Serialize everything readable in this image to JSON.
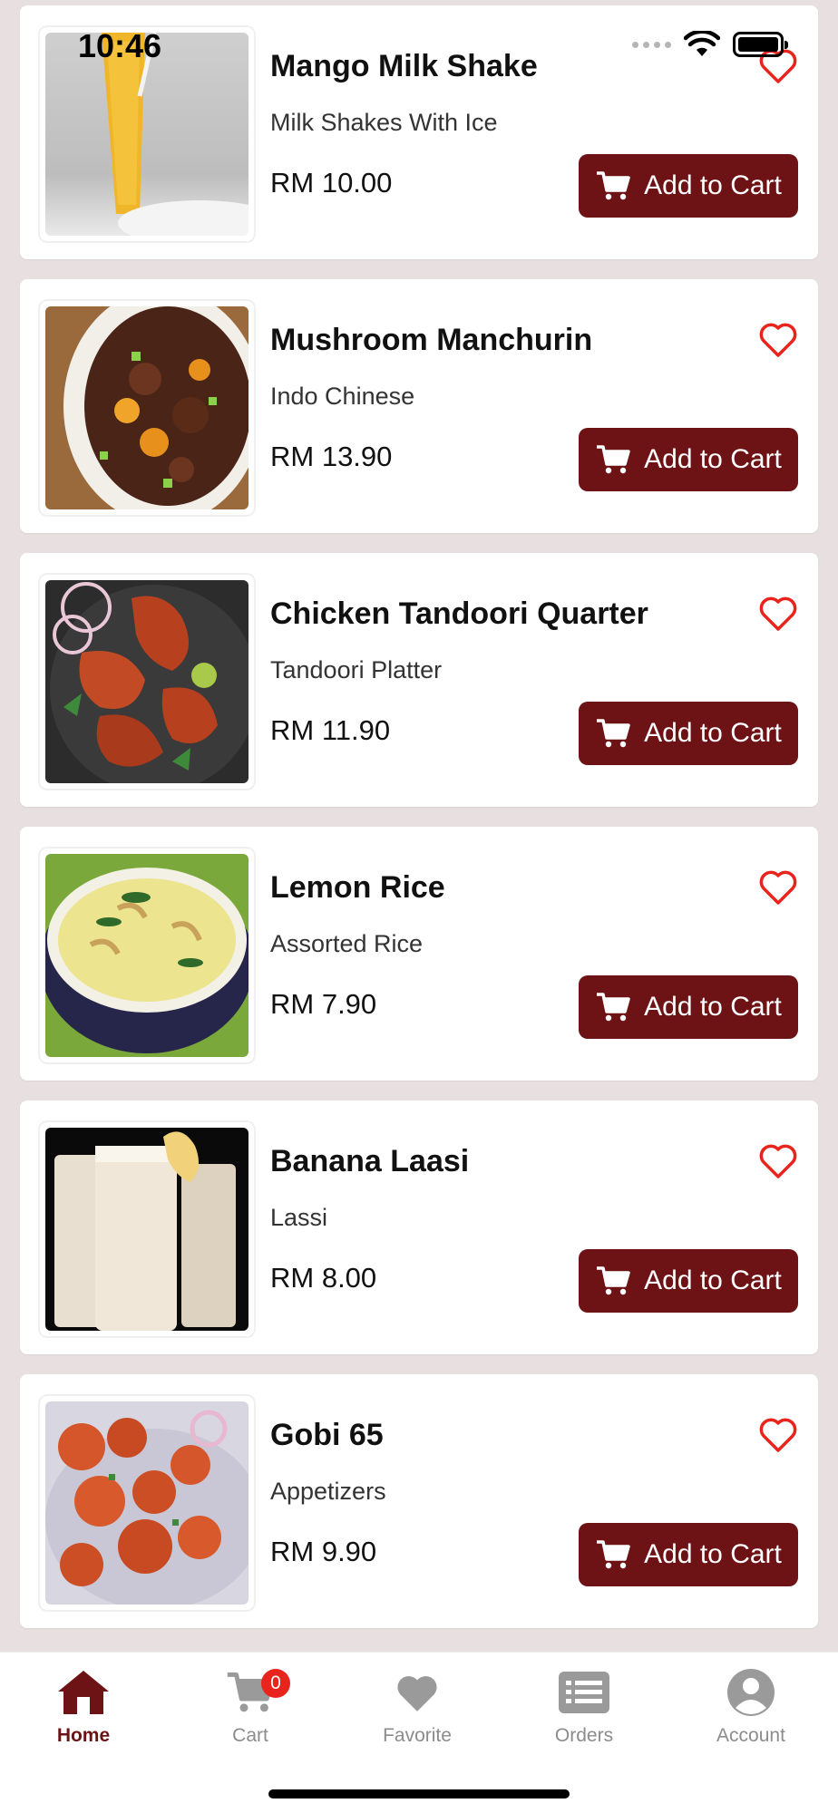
{
  "status_bar": {
    "time": "10:46"
  },
  "items": [
    {
      "name": "Mango Milk Shake",
      "category": "Milk Shakes With Ice",
      "price": "RM 10.00",
      "button": "Add to Cart"
    },
    {
      "name": "Mushroom Manchurin",
      "category": "Indo Chinese",
      "price": "RM 13.90",
      "button": "Add to Cart"
    },
    {
      "name": "Chicken Tandoori Quarter",
      "category": "Tandoori Platter",
      "price": "RM 11.90",
      "button": "Add to Cart"
    },
    {
      "name": "Lemon Rice",
      "category": "Assorted Rice",
      "price": "RM 7.90",
      "button": "Add to Cart"
    },
    {
      "name": "Banana Laasi",
      "category": "Lassi",
      "price": "RM 8.00",
      "button": "Add to Cart"
    },
    {
      "name": "Gobi 65",
      "category": "Appetizers",
      "price": "RM 9.90",
      "button": "Add to Cart"
    }
  ],
  "nav": {
    "home": "Home",
    "cart": "Cart",
    "cart_count": "0",
    "favorite": "Favorite",
    "orders": "Orders",
    "account": "Account"
  },
  "colors": {
    "brand": "#6e1315",
    "heart": "#e8241d",
    "background": "#e8e0e0",
    "nav_inactive": "#8c8c8c"
  }
}
